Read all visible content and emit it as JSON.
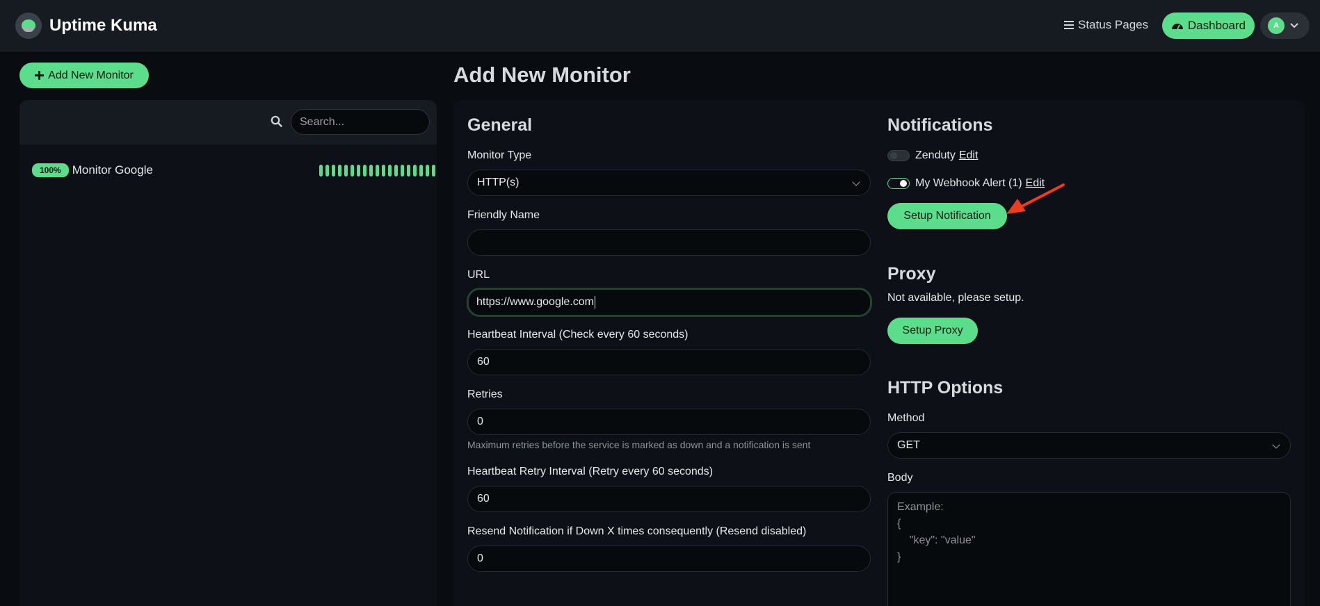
{
  "header": {
    "brand": "Uptime Kuma",
    "status_pages": "Status Pages",
    "dashboard": "Dashboard",
    "avatar_initial": "A"
  },
  "sidebar": {
    "add_monitor": "Add New Monitor",
    "search_placeholder": "Search...",
    "monitors": [
      {
        "uptime": "100%",
        "name": "Monitor Google",
        "heartbeats_up": 20
      }
    ]
  },
  "main": {
    "title": "Add New Monitor",
    "general": {
      "heading": "General",
      "monitor_type_label": "Monitor Type",
      "monitor_type_value": "HTTP(s)",
      "friendly_name_label": "Friendly Name",
      "friendly_name_value": "",
      "url_label": "URL",
      "url_value": "https://www.google.com",
      "interval_label": "Heartbeat Interval (Check every 60 seconds)",
      "interval_value": "60",
      "retries_label": "Retries",
      "retries_value": "0",
      "retries_hint": "Maximum retries before the service is marked as down and a notification is sent",
      "retry_interval_label": "Heartbeat Retry Interval (Retry every 60 seconds)",
      "retry_interval_value": "60",
      "resend_label": "Resend Notification if Down X times consequently (Resend disabled)",
      "resend_value": "0"
    },
    "notifications": {
      "heading": "Notifications",
      "items": [
        {
          "name": "Zenduty",
          "edit": "Edit",
          "enabled": false
        },
        {
          "name": "My Webhook Alert (1)",
          "edit": "Edit",
          "enabled": true
        }
      ],
      "setup_button": "Setup Notification"
    },
    "proxy": {
      "heading": "Proxy",
      "message": "Not available, please setup.",
      "setup_button": "Setup Proxy"
    },
    "http_options": {
      "heading": "HTTP Options",
      "method_label": "Method",
      "method_value": "GET",
      "body_label": "Body",
      "body_placeholder": "Example:\n{\n    \"key\": \"value\"\n}"
    }
  },
  "colors": {
    "accent": "#5cdd8b",
    "background": "#090c10",
    "panel": "#0d1117",
    "annotation_arrow": "#ee3b22"
  }
}
